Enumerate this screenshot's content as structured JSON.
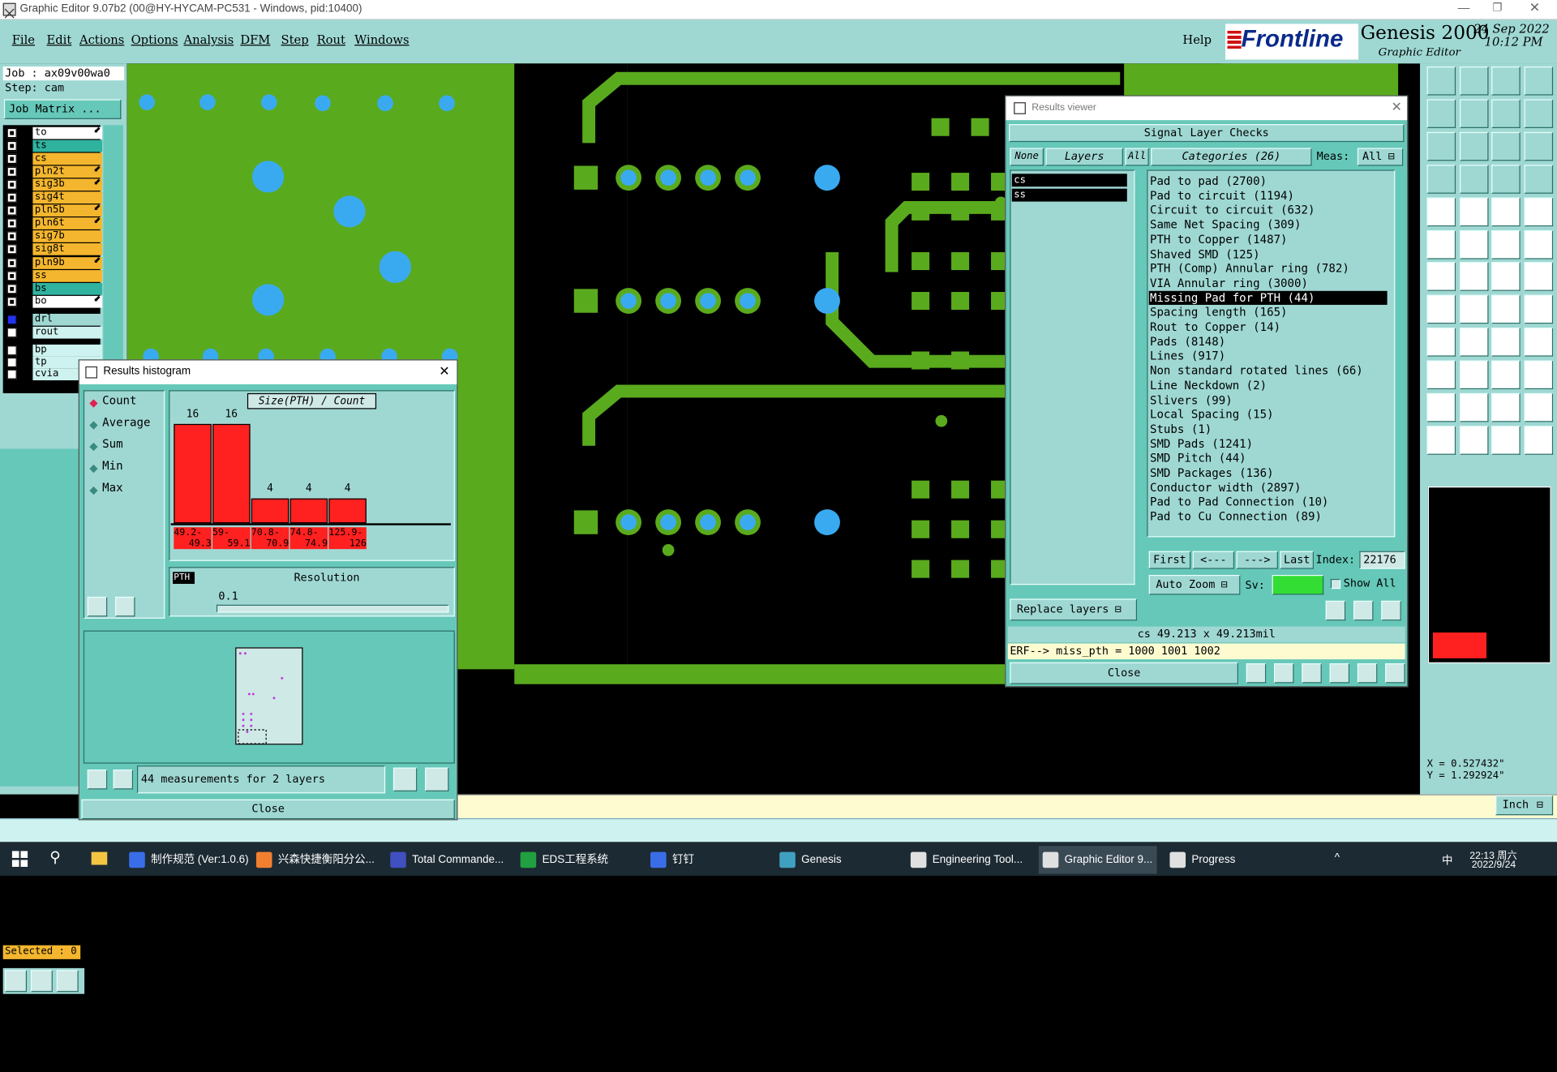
{
  "window": {
    "title": "Graphic Editor 9.07b2 (00@HY-HYCAM-PC531 - Windows, pid:10400)"
  },
  "menu": {
    "items": [
      "File",
      "Edit",
      "Actions",
      "Options",
      "Analysis",
      "DFM",
      "Step",
      "Rout",
      "Windows"
    ],
    "help": "Help"
  },
  "brand": {
    "logo": "Frontline",
    "product": "Genesis 2000",
    "sub": "Graphic Editor",
    "date": "24 Sep 2022",
    "time": "10:12 PM"
  },
  "job": {
    "job_label": "Job  : ax09v00wa0",
    "step_label": "Step: cam",
    "matrix_button": "Job Matrix ..."
  },
  "layers": [
    {
      "name": "to",
      "color": "#ffffff",
      "arrow": true
    },
    {
      "name": "ts",
      "color": "#2fb39f",
      "arrow": false
    },
    {
      "name": "cs",
      "color": "#f4b62e",
      "arrow": false
    },
    {
      "name": "pln2t",
      "color": "#f4b62e",
      "arrow": true
    },
    {
      "name": "sig3b",
      "color": "#f4b62e",
      "arrow": true
    },
    {
      "name": "sig4t",
      "color": "#f4b62e",
      "arrow": false
    },
    {
      "name": "pln5b",
      "color": "#f4b62e",
      "arrow": true
    },
    {
      "name": "pln6t",
      "color": "#f4b62e",
      "arrow": true
    },
    {
      "name": "sig7b",
      "color": "#f4b62e",
      "arrow": false
    },
    {
      "name": "sig8t",
      "color": "#f4b62e",
      "arrow": false
    },
    {
      "name": "pln9b",
      "color": "#f4b62e",
      "arrow": true
    },
    {
      "name": "ss",
      "color": "#f4b62e",
      "arrow": false
    },
    {
      "name": "bs",
      "color": "#2fb39f",
      "arrow": false
    },
    {
      "name": "bo",
      "color": "#ffffff",
      "arrow": true
    }
  ],
  "drill_layers": [
    "drl",
    "rout"
  ],
  "extra_layers": [
    "bp",
    "tp",
    "cvia"
  ],
  "selected_label": "Selected : 0",
  "histogram": {
    "title": "Results histogram",
    "options": [
      "Count",
      "Average",
      "Sum",
      "Min",
      "Max"
    ],
    "selected_option": "Count",
    "chart_title": "Size(PTH) / Count",
    "bar_values": [
      "16",
      "16",
      "4",
      "4",
      "4"
    ],
    "bar_labels": [
      [
        "49.2-",
        "49.3"
      ],
      [
        "59-",
        "59.1"
      ],
      [
        "70.8-",
        "70.9"
      ],
      [
        "74.8-",
        "74.9"
      ],
      [
        "125.9-",
        "126"
      ]
    ],
    "pth_label": "PTH",
    "resolution_label": "Resolution",
    "resolution_value": "0.1",
    "status": "44 measurements for 2 layers",
    "close_label": "Close"
  },
  "results": {
    "title": "Results viewer",
    "header": "Signal Layer Checks",
    "none_label": "None",
    "layers_label": "Layers",
    "all_label": "All",
    "categories_label": "Categories (26)",
    "meas_label": "Meas:",
    "meas_value": "All",
    "layer_list": [
      "cs",
      "ss"
    ],
    "categories": [
      "Pad to pad (2700)",
      "Pad to circuit (1194)",
      "Circuit to circuit (632)",
      "Same Net Spacing (309)",
      "PTH to Copper (1487)",
      "Shaved SMD (125)",
      "PTH (Comp) Annular ring (782)",
      "VIA Annular ring (3000)",
      "Missing Pad for PTH (44)",
      "Spacing length (165)",
      "Rout to Copper (14)",
      "Pads (8148)",
      "Lines (917)",
      "Non standard rotated lines (66)",
      "Line Neckdown (2)",
      "Slivers (99)",
      "Local Spacing (15)",
      "Stubs (1)",
      "SMD Pads (1241)",
      "SMD Pitch (44)",
      "SMD Packages (136)",
      "Conductor width (2897)",
      "Pad to Pad Connection (10)",
      "Pad to Cu Connection (89)"
    ],
    "selected_index": 8,
    "nav": {
      "first": "First",
      "prev": "<---",
      "next": "--->",
      "last": "Last",
      "index_label": "Index:",
      "index_value": "22176"
    },
    "auto_zoom": "Auto Zoom",
    "sv_label": "Sv:",
    "show_all": "Show All",
    "replace_layers": "Replace layers",
    "measure_text": "cs 49.213 x 49.213mil",
    "erf_text": "ERF--> miss_pth = 1000 1001 1002",
    "close_label": "Close"
  },
  "coords": {
    "x": "X = 0.527432\"",
    "y": "Y = 1.292924\""
  },
  "units": "Inch",
  "taskbar": {
    "items": [
      "制作规范 (Ver:1.0.6)",
      "兴森快捷衡阳分公...",
      "Total Commande...",
      "EDS工程系统",
      "钉钉",
      "Genesis",
      "Engineering Tool...",
      "Graphic Editor 9...",
      "Progress"
    ],
    "time": "22:13 周六",
    "date": "2022/9/24",
    "ime": "中"
  },
  "colors": {
    "panel": "#9fd8d3",
    "board": "#5aaa1e",
    "pad_blue": "#3aaaf0",
    "highlight": "#ff2020"
  }
}
